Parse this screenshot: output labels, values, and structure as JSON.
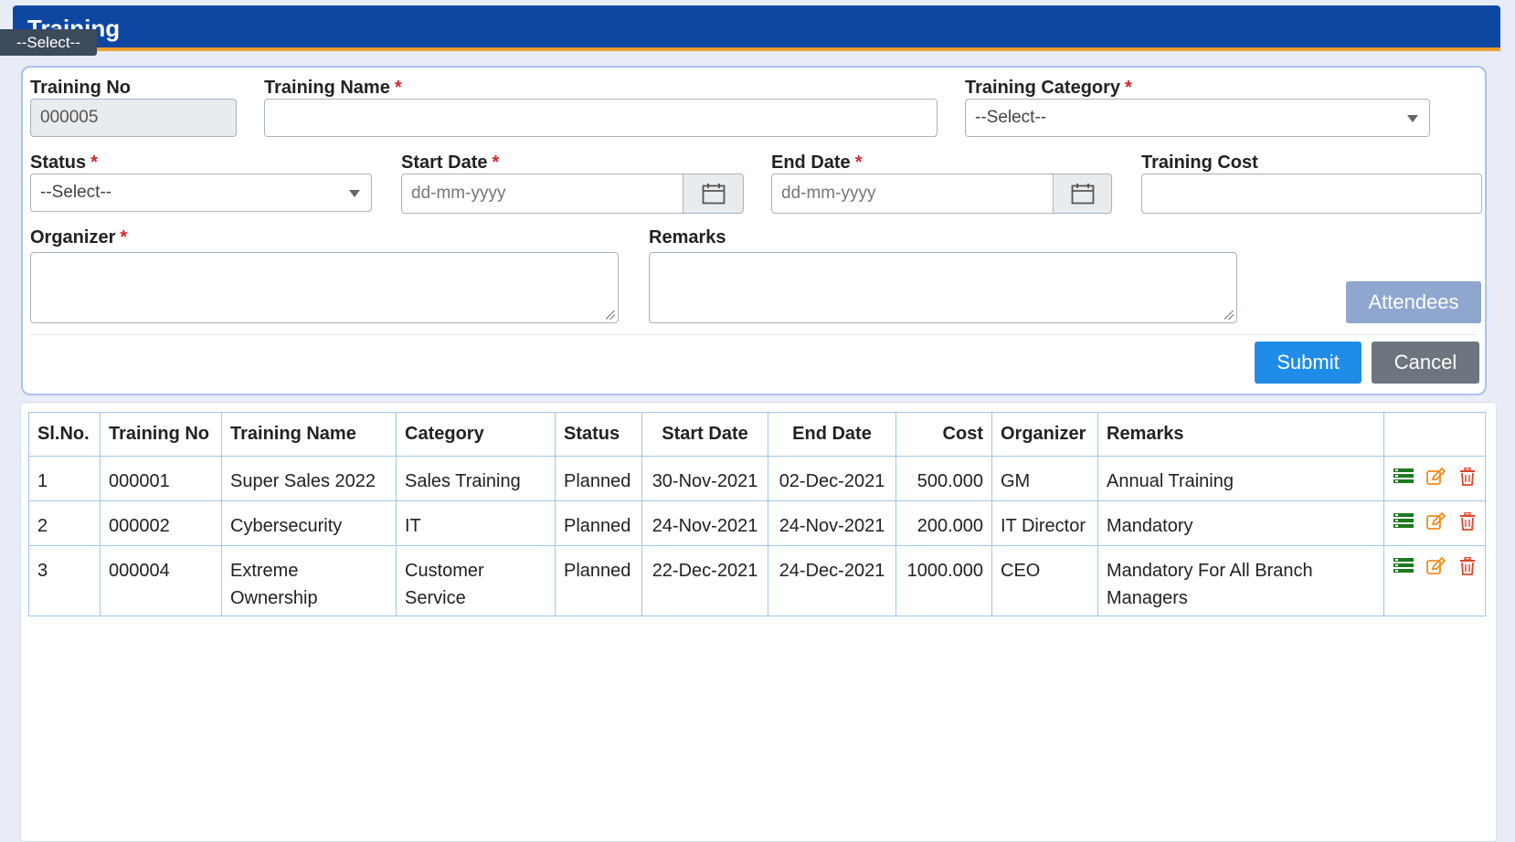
{
  "header": {
    "title": "Training",
    "tooltip": "--Select--"
  },
  "form": {
    "training_no": {
      "label": "Training No",
      "value": "000005"
    },
    "training_name": {
      "label": "Training Name",
      "required": "*",
      "value": ""
    },
    "training_category": {
      "label": "Training Category",
      "required": "*",
      "value": "--Select--"
    },
    "status": {
      "label": "Status",
      "required": "*",
      "value": "--Select--"
    },
    "start_date": {
      "label": "Start Date",
      "required": "*",
      "placeholder": "dd-mm-yyyy"
    },
    "end_date": {
      "label": "End Date",
      "required": "*",
      "placeholder": "dd-mm-yyyy"
    },
    "training_cost": {
      "label": "Training Cost",
      "value": ""
    },
    "organizer": {
      "label": "Organizer",
      "required": "*",
      "value": ""
    },
    "remarks": {
      "label": "Remarks",
      "value": ""
    },
    "attendees_label": "Attendees",
    "submit_label": "Submit",
    "cancel_label": "Cancel"
  },
  "table": {
    "headers": [
      "Sl.No.",
      "Training No",
      "Training Name",
      "Category",
      "Status",
      "Start Date",
      "End Date",
      "Cost",
      "Organizer",
      "Remarks",
      ""
    ],
    "rows": [
      [
        "1",
        "000001",
        "Super Sales 2022",
        "Sales Training",
        "Planned",
        "30-Nov-2021",
        "02-Dec-2021",
        "500.000",
        "GM",
        "Annual Training"
      ],
      [
        "2",
        "000002",
        "Cybersecurity",
        "IT",
        "Planned",
        "24-Nov-2021",
        "24-Nov-2021",
        "200.000",
        "IT Director",
        "Mandatory"
      ],
      [
        "3",
        "000004",
        "Extreme Ownership",
        "Customer Service",
        "Planned",
        "22-Dec-2021",
        "24-Dec-2021",
        "1000.000",
        "CEO",
        "Mandatory For All Branch Managers"
      ]
    ]
  },
  "colors": {
    "header_bg": "#0e47a1",
    "accent_stripe": "#f0a030",
    "required": "#d9242b",
    "submit": "#1f8de8",
    "cancel": "#6d757e",
    "attendees": "#8fa6cf",
    "view_icon": "#1d7a1d",
    "edit_icon": "#f08c1a",
    "delete_icon": "#e0452b"
  },
  "icons": [
    "calendar-icon",
    "chevron-down-icon",
    "list-view-icon",
    "edit-icon",
    "trash-icon"
  ]
}
